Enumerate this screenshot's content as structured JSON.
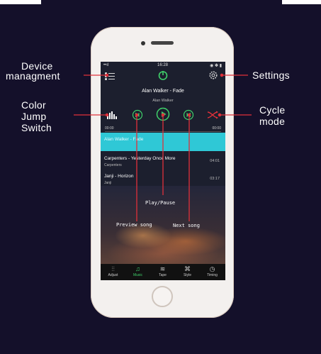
{
  "annotations": {
    "device_management_line1": "Device",
    "device_management_line2": "managment",
    "settings": "Settings",
    "color_jump_line1": "Color",
    "color_jump_line2": "Jump",
    "color_jump_line3": "Switch",
    "cycle_line1": "Cycle",
    "cycle_line2": "mode",
    "play_pause": "Play/Pause",
    "preview_song": "Preview song",
    "next_song": "Next song"
  },
  "status_bar": {
    "signal": "••ıl",
    "time": "16:28",
    "battery": "◉ ✽ ▮"
  },
  "now_playing": {
    "title": "Alan Walker - Fade",
    "artist": "Alan Walker"
  },
  "progress": {
    "elapsed": "00:00",
    "total": "00:00",
    "fraction": 0.0
  },
  "playlist": [
    {
      "title": "Alan Walker - Fade",
      "artist": "",
      "duration": "",
      "active": true
    },
    {
      "title": "Carpenters - Yesterday Once More",
      "artist": "Carpenters",
      "duration": "04:01",
      "active": false
    },
    {
      "title": "Janji - Horizon",
      "artist": "Janji",
      "duration": "03:17",
      "active": false
    }
  ],
  "tabs": [
    {
      "label": "Adjust",
      "icon": "sliders-icon",
      "glyph": "⫶⫶"
    },
    {
      "label": "Music",
      "icon": "music-icon",
      "glyph": "♫",
      "selected": true
    },
    {
      "label": "Tape",
      "icon": "wave-icon",
      "glyph": "≋"
    },
    {
      "label": "Style",
      "icon": "command-icon",
      "glyph": "⌘"
    },
    {
      "label": "Timing",
      "icon": "clock-icon",
      "glyph": "◷"
    }
  ],
  "colors": {
    "accent": "#3fd06a",
    "active_row": "#2fc8d6",
    "callout_line": "#e0303a",
    "background": "#14102a"
  }
}
